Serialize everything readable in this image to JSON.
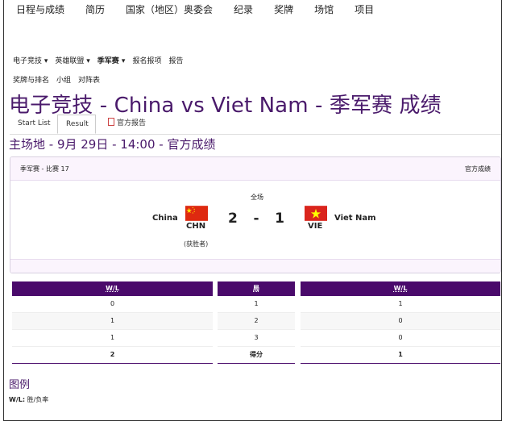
{
  "topnav": [
    "日程与成绩",
    "简历",
    "国家（地区）奥委会",
    "纪录",
    "奖牌",
    "场馆",
    "项目"
  ],
  "subnav1": [
    "电子竞技 ▾",
    "英雄联盟 ▾",
    "季军赛 ▾",
    "报名报项",
    "报告"
  ],
  "subnav2": [
    "奖牌与排名",
    "小组",
    "对阵表"
  ],
  "page_title": "电子竞技 - China vs Viet Nam - 季军赛 成绩",
  "tabs": {
    "start_list": "Start List",
    "result": "Result",
    "report": "官方报告"
  },
  "subtitle": "主场地 - 9月 29日 - 14:00 - 官方成绩",
  "match": {
    "header_left": "季军赛 - 比赛 17",
    "header_right": "官方成绩",
    "period": "全场",
    "home_name": "China",
    "home_code": "CHN",
    "away_name": "Viet Nam",
    "away_code": "VIE",
    "home_score": "2",
    "dash": "-",
    "away_score": "1",
    "winner_label": "(获胜者)"
  },
  "table": {
    "col_left": "W/L",
    "col_mid": "局",
    "col_right": "W/L",
    "rows": [
      {
        "left": "0",
        "mid": "1",
        "right": "1"
      },
      {
        "left": "1",
        "mid": "2",
        "right": "0"
      },
      {
        "left": "1",
        "mid": "3",
        "right": "0"
      }
    ],
    "total": {
      "left": "2",
      "mid": "得分",
      "right": "1"
    }
  },
  "legend": {
    "title": "图例",
    "key": "W/L:",
    "desc": " 胜/负率"
  },
  "colors": {
    "accent": "#4a0a6b",
    "title_purple": "#4a1a6b",
    "card_tint": "#fbf4fd"
  }
}
